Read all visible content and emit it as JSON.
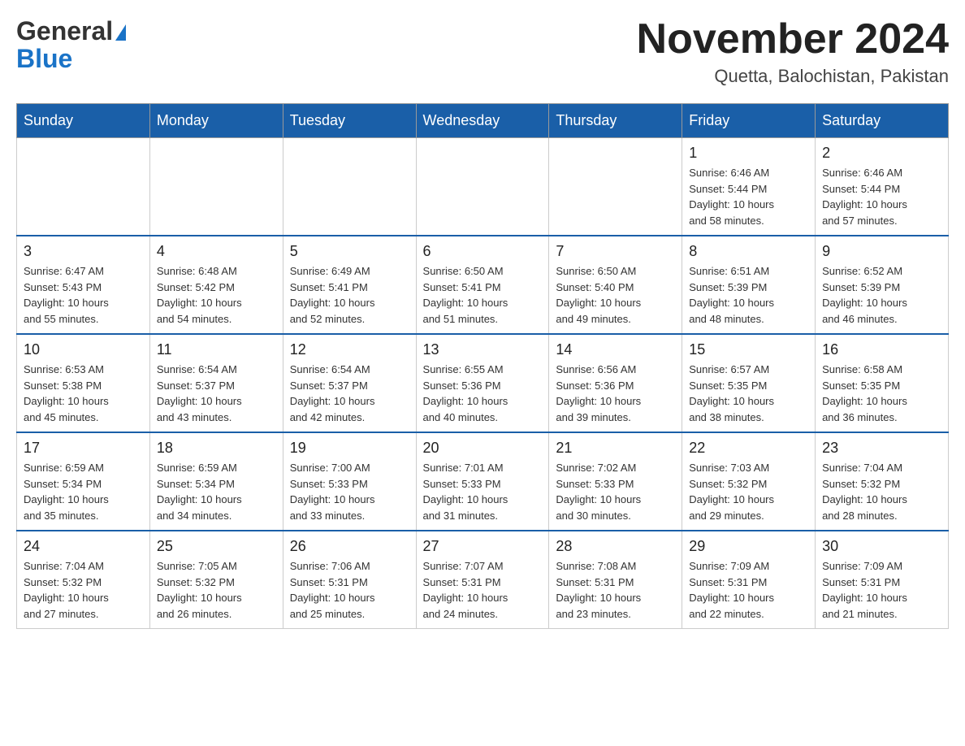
{
  "header": {
    "logo_general": "General",
    "logo_blue": "Blue",
    "title": "November 2024",
    "subtitle": "Quetta, Balochistan, Pakistan"
  },
  "weekdays": [
    "Sunday",
    "Monday",
    "Tuesday",
    "Wednesday",
    "Thursday",
    "Friday",
    "Saturday"
  ],
  "weeks": [
    [
      {
        "day": "",
        "info": ""
      },
      {
        "day": "",
        "info": ""
      },
      {
        "day": "",
        "info": ""
      },
      {
        "day": "",
        "info": ""
      },
      {
        "day": "",
        "info": ""
      },
      {
        "day": "1",
        "info": "Sunrise: 6:46 AM\nSunset: 5:44 PM\nDaylight: 10 hours\nand 58 minutes."
      },
      {
        "day": "2",
        "info": "Sunrise: 6:46 AM\nSunset: 5:44 PM\nDaylight: 10 hours\nand 57 minutes."
      }
    ],
    [
      {
        "day": "3",
        "info": "Sunrise: 6:47 AM\nSunset: 5:43 PM\nDaylight: 10 hours\nand 55 minutes."
      },
      {
        "day": "4",
        "info": "Sunrise: 6:48 AM\nSunset: 5:42 PM\nDaylight: 10 hours\nand 54 minutes."
      },
      {
        "day": "5",
        "info": "Sunrise: 6:49 AM\nSunset: 5:41 PM\nDaylight: 10 hours\nand 52 minutes."
      },
      {
        "day": "6",
        "info": "Sunrise: 6:50 AM\nSunset: 5:41 PM\nDaylight: 10 hours\nand 51 minutes."
      },
      {
        "day": "7",
        "info": "Sunrise: 6:50 AM\nSunset: 5:40 PM\nDaylight: 10 hours\nand 49 minutes."
      },
      {
        "day": "8",
        "info": "Sunrise: 6:51 AM\nSunset: 5:39 PM\nDaylight: 10 hours\nand 48 minutes."
      },
      {
        "day": "9",
        "info": "Sunrise: 6:52 AM\nSunset: 5:39 PM\nDaylight: 10 hours\nand 46 minutes."
      }
    ],
    [
      {
        "day": "10",
        "info": "Sunrise: 6:53 AM\nSunset: 5:38 PM\nDaylight: 10 hours\nand 45 minutes."
      },
      {
        "day": "11",
        "info": "Sunrise: 6:54 AM\nSunset: 5:37 PM\nDaylight: 10 hours\nand 43 minutes."
      },
      {
        "day": "12",
        "info": "Sunrise: 6:54 AM\nSunset: 5:37 PM\nDaylight: 10 hours\nand 42 minutes."
      },
      {
        "day": "13",
        "info": "Sunrise: 6:55 AM\nSunset: 5:36 PM\nDaylight: 10 hours\nand 40 minutes."
      },
      {
        "day": "14",
        "info": "Sunrise: 6:56 AM\nSunset: 5:36 PM\nDaylight: 10 hours\nand 39 minutes."
      },
      {
        "day": "15",
        "info": "Sunrise: 6:57 AM\nSunset: 5:35 PM\nDaylight: 10 hours\nand 38 minutes."
      },
      {
        "day": "16",
        "info": "Sunrise: 6:58 AM\nSunset: 5:35 PM\nDaylight: 10 hours\nand 36 minutes."
      }
    ],
    [
      {
        "day": "17",
        "info": "Sunrise: 6:59 AM\nSunset: 5:34 PM\nDaylight: 10 hours\nand 35 minutes."
      },
      {
        "day": "18",
        "info": "Sunrise: 6:59 AM\nSunset: 5:34 PM\nDaylight: 10 hours\nand 34 minutes."
      },
      {
        "day": "19",
        "info": "Sunrise: 7:00 AM\nSunset: 5:33 PM\nDaylight: 10 hours\nand 33 minutes."
      },
      {
        "day": "20",
        "info": "Sunrise: 7:01 AM\nSunset: 5:33 PM\nDaylight: 10 hours\nand 31 minutes."
      },
      {
        "day": "21",
        "info": "Sunrise: 7:02 AM\nSunset: 5:33 PM\nDaylight: 10 hours\nand 30 minutes."
      },
      {
        "day": "22",
        "info": "Sunrise: 7:03 AM\nSunset: 5:32 PM\nDaylight: 10 hours\nand 29 minutes."
      },
      {
        "day": "23",
        "info": "Sunrise: 7:04 AM\nSunset: 5:32 PM\nDaylight: 10 hours\nand 28 minutes."
      }
    ],
    [
      {
        "day": "24",
        "info": "Sunrise: 7:04 AM\nSunset: 5:32 PM\nDaylight: 10 hours\nand 27 minutes."
      },
      {
        "day": "25",
        "info": "Sunrise: 7:05 AM\nSunset: 5:32 PM\nDaylight: 10 hours\nand 26 minutes."
      },
      {
        "day": "26",
        "info": "Sunrise: 7:06 AM\nSunset: 5:31 PM\nDaylight: 10 hours\nand 25 minutes."
      },
      {
        "day": "27",
        "info": "Sunrise: 7:07 AM\nSunset: 5:31 PM\nDaylight: 10 hours\nand 24 minutes."
      },
      {
        "day": "28",
        "info": "Sunrise: 7:08 AM\nSunset: 5:31 PM\nDaylight: 10 hours\nand 23 minutes."
      },
      {
        "day": "29",
        "info": "Sunrise: 7:09 AM\nSunset: 5:31 PM\nDaylight: 10 hours\nand 22 minutes."
      },
      {
        "day": "30",
        "info": "Sunrise: 7:09 AM\nSunset: 5:31 PM\nDaylight: 10 hours\nand 21 minutes."
      }
    ]
  ]
}
